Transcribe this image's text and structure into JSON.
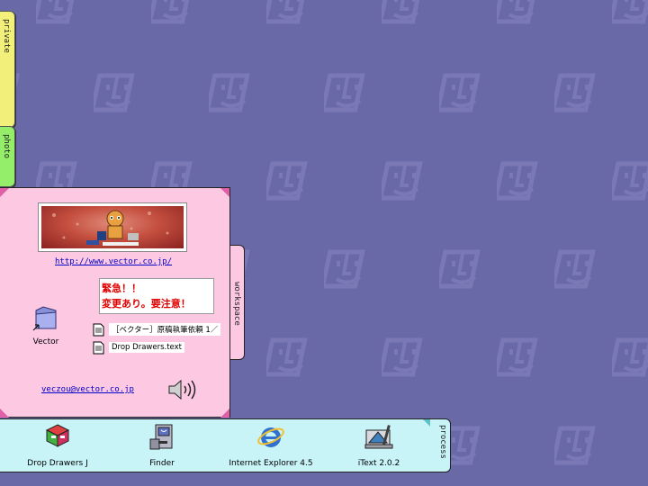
{
  "desktop": {
    "background": "#6a69a8"
  },
  "tabs": {
    "private": "private",
    "photo": "photo",
    "workspace": "workspace",
    "process": "process"
  },
  "drawer": {
    "url": "http://www.vector.co.jp/",
    "notice": {
      "line1": "緊急！！",
      "line2": "変更あり。要注意！"
    },
    "folder": {
      "label": "Vector",
      "icon": "folder-alias-icon"
    },
    "files": [
      {
        "label": "［ベクター］原稿執筆依頼 1／",
        "icon": "text-document-icon"
      },
      {
        "label": "Drop Drawers.text",
        "icon": "text-document-icon"
      }
    ],
    "email": "veczou@vector.co.jp",
    "sound_icon": "speaker-icon"
  },
  "dock": {
    "apps": [
      {
        "label": "Drop Drawers J",
        "icon": "drop-drawers-icon"
      },
      {
        "label": "Finder",
        "icon": "finder-icon"
      },
      {
        "label": "Internet Explorer 4.5",
        "icon": "internet-explorer-icon"
      },
      {
        "label": "iText 2.0.2",
        "icon": "itext-icon"
      }
    ]
  }
}
